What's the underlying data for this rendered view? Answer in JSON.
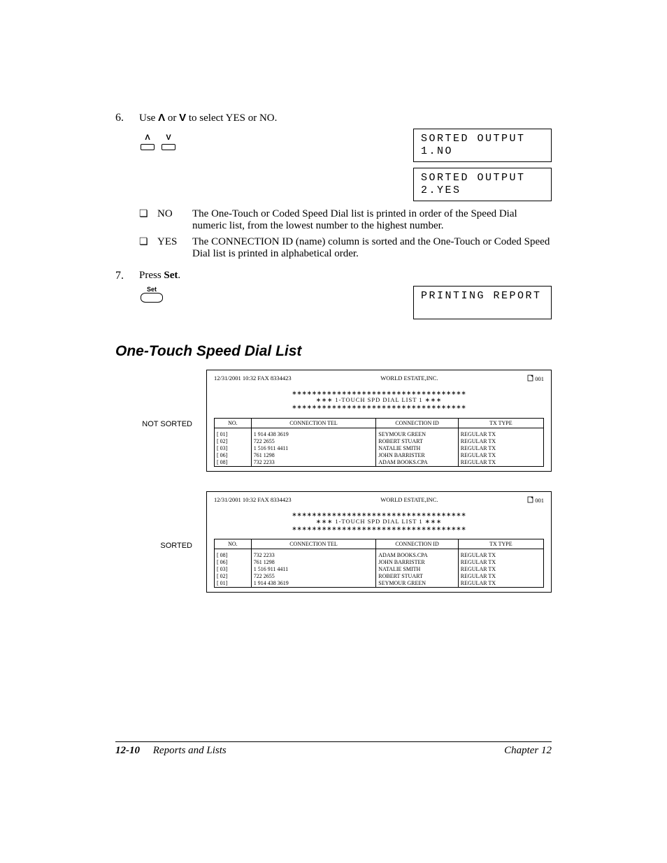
{
  "step6": {
    "num": "6.",
    "text_before": "Use ",
    "up": "u",
    "or": " or ",
    "down": "d",
    "text_after": " to select YES or NO."
  },
  "lcd1_line1": "SORTED OUTPUT",
  "lcd1_line2": " 1.NO",
  "lcd2_line1": "SORTED OUTPUT",
  "lcd2_line2": " 2.YES",
  "opt_no_key": "NO",
  "opt_no_text": "The One-Touch or Coded Speed Dial list is printed in order of the Speed Dial numeric list, from the lowest number to the highest number.",
  "opt_yes_key": "YES",
  "opt_yes_text": "The CONNECTION ID (name) column is sorted and the One-Touch or Coded Speed Dial list is printed in alphabetical order.",
  "step7": {
    "num": "7.",
    "text_before": "Press ",
    "bold": "Set",
    "after": "."
  },
  "set_label": "Set",
  "lcd3": "PRINTING REPORT",
  "section_heading": "One-Touch Speed Dial List",
  "side_not_sorted": "NOT SORTED",
  "side_sorted": "SORTED",
  "report_common": {
    "timestamp": "12/31/2001 10:32    FAX    8334423",
    "company": "WORLD ESTATE,INC.",
    "pageno": "001",
    "stars": "∗∗∗∗∗∗∗∗∗∗∗∗∗∗∗∗∗∗∗∗∗∗∗∗∗∗∗∗∗∗∗∗∗∗∗",
    "title_mid": "∗∗∗      1-TOUCH SPD DIAL LIST 1      ∗∗∗",
    "col_no": "NO.",
    "col_tel": "CONNECTION TEL",
    "col_id": "CONNECTION ID",
    "col_tx": "TX TYPE"
  },
  "rows_unsorted": [
    {
      "no": "[      01]",
      "tel": "1 914 438 3619",
      "id": "SEYMOUR GREEN",
      "tx": "REGULAR TX"
    },
    {
      "no": "[      02]",
      "tel": "722 2655",
      "id": "ROBERT STUART",
      "tx": "REGULAR TX"
    },
    {
      "no": "[      03]",
      "tel": "1 516 911 4411",
      "id": "NATALIE SMITH",
      "tx": "REGULAR TX"
    },
    {
      "no": "[      06]",
      "tel": "761 1298",
      "id": "JOHN BARRISTER",
      "tx": "REGULAR TX"
    },
    {
      "no": "[      08]",
      "tel": "732 2233",
      "id": "ADAM BOOKS.CPA",
      "tx": "REGULAR TX"
    }
  ],
  "rows_sorted": [
    {
      "no": "[      08]",
      "tel": "732 2233",
      "id": "ADAM BOOKS.CPA",
      "tx": "REGULAR TX"
    },
    {
      "no": "[      06]",
      "tel": "761 1298",
      "id": "JOHN BARRISTER",
      "tx": "REGULAR TX"
    },
    {
      "no": "[      03]",
      "tel": "1 516 911 4411",
      "id": "NATALIE SMITH",
      "tx": "REGULAR TX"
    },
    {
      "no": "[      02]",
      "tel": "722 2655",
      "id": "ROBERT STUART",
      "tx": "REGULAR TX"
    },
    {
      "no": "[      01]",
      "tel": "1 914 438 3619",
      "id": "SEYMOUR GREEN",
      "tx": "REGULAR TX"
    }
  ],
  "footer": {
    "page": "12-10",
    "section": "Reports and Lists",
    "chapter": "Chapter 12"
  }
}
